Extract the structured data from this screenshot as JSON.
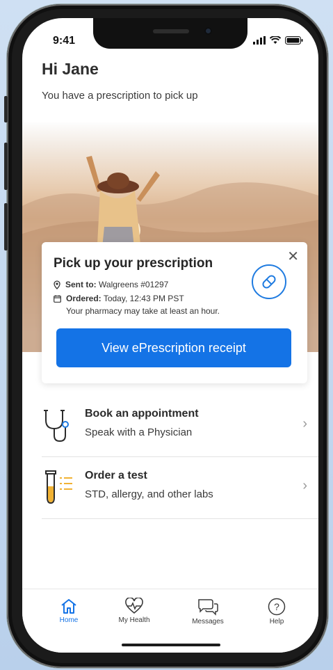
{
  "status": {
    "time": "9:41"
  },
  "greeting": {
    "title": "Hi Jane",
    "subtitle": "You have a prescription to pick up"
  },
  "card": {
    "title": "Pick up your prescription",
    "sent_label": "Sent to:",
    "sent_value": "Walgreens #01297",
    "ordered_label": "Ordered:",
    "ordered_value": "Today, 12:43 PM PST",
    "note": "Your pharmacy may take at least an hour.",
    "button": "View ePrescription receipt"
  },
  "list": [
    {
      "title": "Book an appointment",
      "subtitle": "Speak with a Physician",
      "icon": "stethoscope-icon"
    },
    {
      "title": "Order a test",
      "subtitle": "STD, allergy, and other labs",
      "icon": "test-tube-icon"
    }
  ],
  "tabs": [
    {
      "label": "Home",
      "icon": "home-icon",
      "active": true
    },
    {
      "label": "My Health",
      "icon": "heart-pulse-icon",
      "active": false
    },
    {
      "label": "Messages",
      "icon": "chat-bubbles-icon",
      "active": false
    },
    {
      "label": "Help",
      "icon": "question-icon",
      "active": false
    }
  ],
  "colors": {
    "accent": "#1473e6",
    "background": "#c7daf0"
  }
}
